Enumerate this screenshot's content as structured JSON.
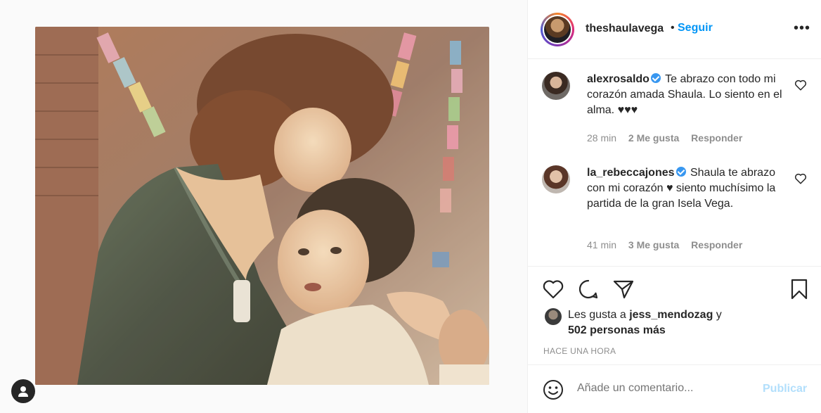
{
  "post": {
    "username": "theshaulavega",
    "separator": "•",
    "follow_label": "Seguir",
    "more_icon": "ellipsis-icon",
    "more_label": "•••"
  },
  "comments": [
    {
      "username": "alexrosaldo",
      "verified": true,
      "text": "Te abrazo con todo mi corazón amada Shaula. Lo siento en el alma. ♥♥♥",
      "time": "28 min",
      "likes": "2 Me gusta",
      "reply": "Responder"
    },
    {
      "username": "la_rebeccajones",
      "verified": true,
      "text": "Shaula te abrazo con mi corazón ♥ siento muchísimo la partida de la gran Isela Vega.",
      "time": "41 min",
      "likes": "3 Me gusta",
      "reply": "Responder"
    }
  ],
  "likes": {
    "prefix": "Les gusta a",
    "user": "jess_mendozag",
    "conj": "y",
    "others": "502 personas más"
  },
  "timestamp": "Hace una hora",
  "composer": {
    "placeholder": "Añade un comentario...",
    "publish_label": "Publicar"
  },
  "colors": {
    "link_blue": "#0095f6",
    "publish_disabled": "#b2dffc",
    "muted": "#8e8e8e",
    "text": "#262626"
  }
}
